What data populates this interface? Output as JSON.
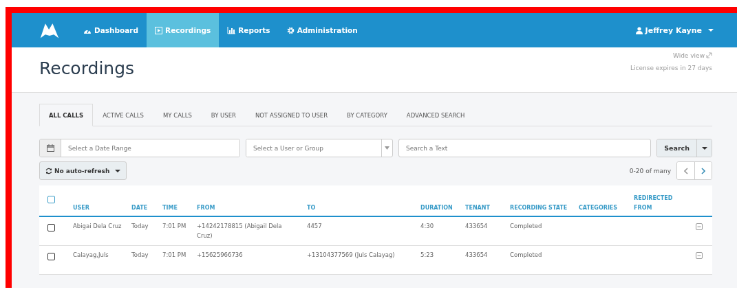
{
  "navbar": {
    "items": [
      {
        "label": "Dashboard",
        "selected": false
      },
      {
        "label": "Recordings",
        "selected": true
      },
      {
        "label": "Reports",
        "selected": false
      },
      {
        "label": "Administration",
        "selected": false
      }
    ],
    "user": "Jeffrey Kayne"
  },
  "page": {
    "title": "Recordings",
    "wide_view": "Wide view",
    "license": "License expires in 27 days"
  },
  "tabs": [
    {
      "label": "ALL CALLS",
      "selected": true
    },
    {
      "label": "ACTIVE CALLS",
      "selected": false
    },
    {
      "label": "MY CALLS",
      "selected": false
    },
    {
      "label": "BY USER",
      "selected": false
    },
    {
      "label": "NOT ASSIGNED TO USER",
      "selected": false
    },
    {
      "label": "BY CATEGORY",
      "selected": false
    },
    {
      "label": "ADVANCED SEARCH",
      "selected": false
    }
  ],
  "filters": {
    "date_placeholder": "Select a Date Range",
    "user_placeholder": "Select a User or Group",
    "text_placeholder": "Search a Text",
    "search_button": "Search"
  },
  "refresh": "No auto-refresh",
  "pager": "0-20 of many",
  "table": {
    "select_all_checked": false,
    "columns": [
      "USER",
      "DATE",
      "TIME",
      "FROM",
      "TO",
      "DURATION",
      "TENANT",
      "RECORDING STATE",
      "CATEGORIES",
      "REDIRECTED FROM"
    ],
    "rows": [
      {
        "checked": false,
        "cells": [
          "Abigai Dela Cruz",
          "Today",
          "7:01 PM",
          "+14242178815 (Abigail Dela Cruz)",
          "4457",
          "4:30",
          "433654",
          "Completed",
          "",
          ""
        ]
      },
      {
        "checked": false,
        "cells": [
          "Calayag,Juls",
          "Today",
          "7:01 PM",
          "+15625966736",
          "+13104377569 (Juls Calayag)",
          "5:23",
          "433654",
          "Completed",
          "",
          ""
        ]
      }
    ]
  }
}
